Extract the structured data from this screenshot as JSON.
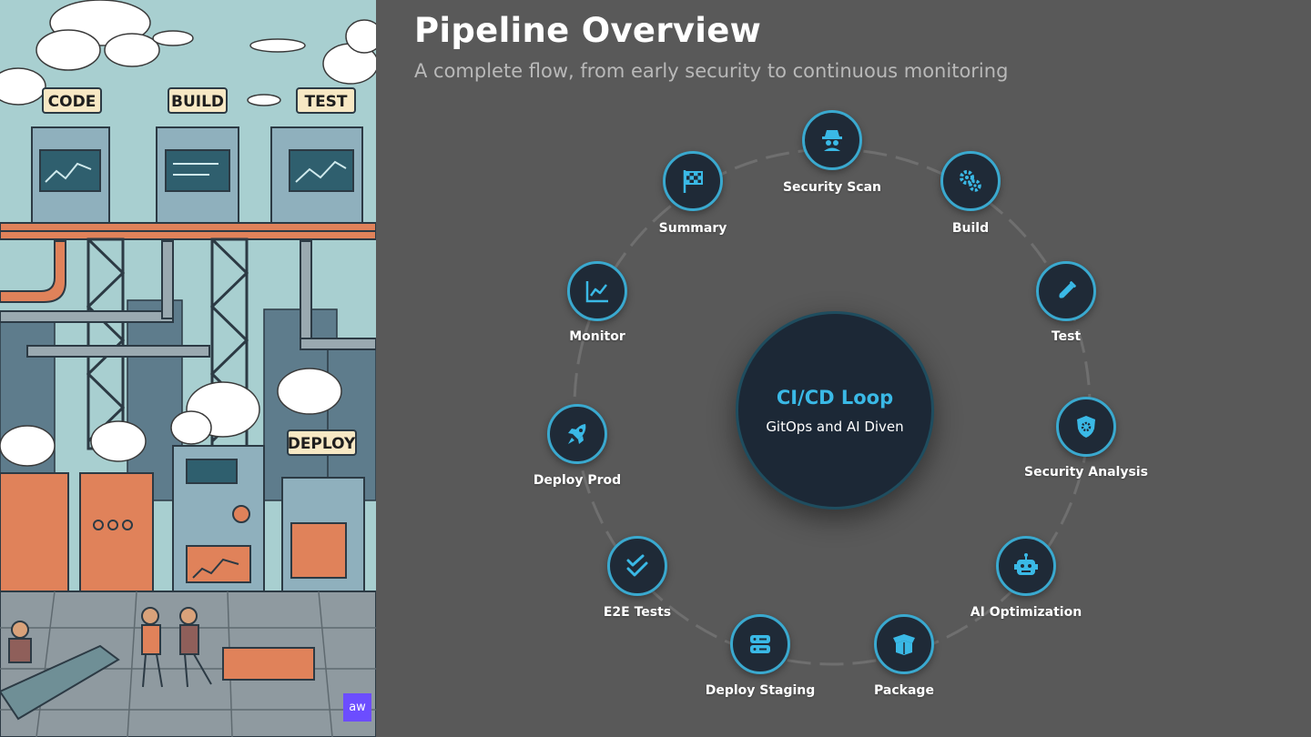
{
  "header": {
    "title": "Pipeline Overview",
    "subtitle": "A complete flow, from early security to continuous monitoring"
  },
  "illustration": {
    "signs": [
      "CODE",
      "BUILD",
      "TEST",
      "DEPLOY"
    ],
    "badge": "aw"
  },
  "loop": {
    "center_title": "CI/CD Loop",
    "center_subtitle": "GitOps and AI Diven",
    "accent_color": "#3ab9e6",
    "ring_color": "#6f6f6f",
    "stages": [
      {
        "label": "Security Scan",
        "icon": "spy-icon"
      },
      {
        "label": "Build",
        "icon": "gears-icon"
      },
      {
        "label": "Test",
        "icon": "test-tube-icon"
      },
      {
        "label": "Security Analysis",
        "icon": "shield-gear-icon"
      },
      {
        "label": "AI Optimization",
        "icon": "robot-icon"
      },
      {
        "label": "Package",
        "icon": "box-open-icon"
      },
      {
        "label": "Deploy Staging",
        "icon": "server-icon"
      },
      {
        "label": "E2E Tests",
        "icon": "double-check-icon"
      },
      {
        "label": "Deploy Prod",
        "icon": "rocket-icon"
      },
      {
        "label": "Monitor",
        "icon": "line-chart-icon"
      },
      {
        "label": "Summary",
        "icon": "checkered-flag-icon"
      }
    ]
  }
}
